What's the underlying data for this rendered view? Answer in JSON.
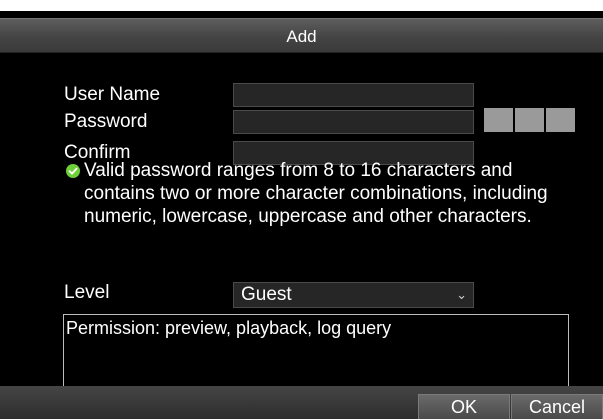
{
  "dialog": {
    "title": "Add",
    "user_name_label": "User Name",
    "password_label": "Password",
    "confirm_label": "Confirm",
    "user_name_value": "",
    "password_value": "",
    "confirm_value": "",
    "password_hint_line1": "Valid password ranges from 8 to 16 characters and",
    "password_hint_rest": "contains two or more character combinations, including numeric, lowercase, uppercase and other characters.",
    "level_label": "Level",
    "level_value": "Guest",
    "permission_text": "Permission: preview, playback, log query",
    "ok_label": "OK",
    "cancel_label": "Cancel"
  },
  "icons": {
    "hint": "check-circle-icon",
    "dropdown": "chevron-down-icon"
  },
  "colors": {
    "background": "#000000",
    "titlebar": "#4a4a4a",
    "field": "#262626",
    "strength_segment": "#9a9a9a",
    "hint_icon": "#6fcf3a",
    "text": "#ffffff"
  }
}
